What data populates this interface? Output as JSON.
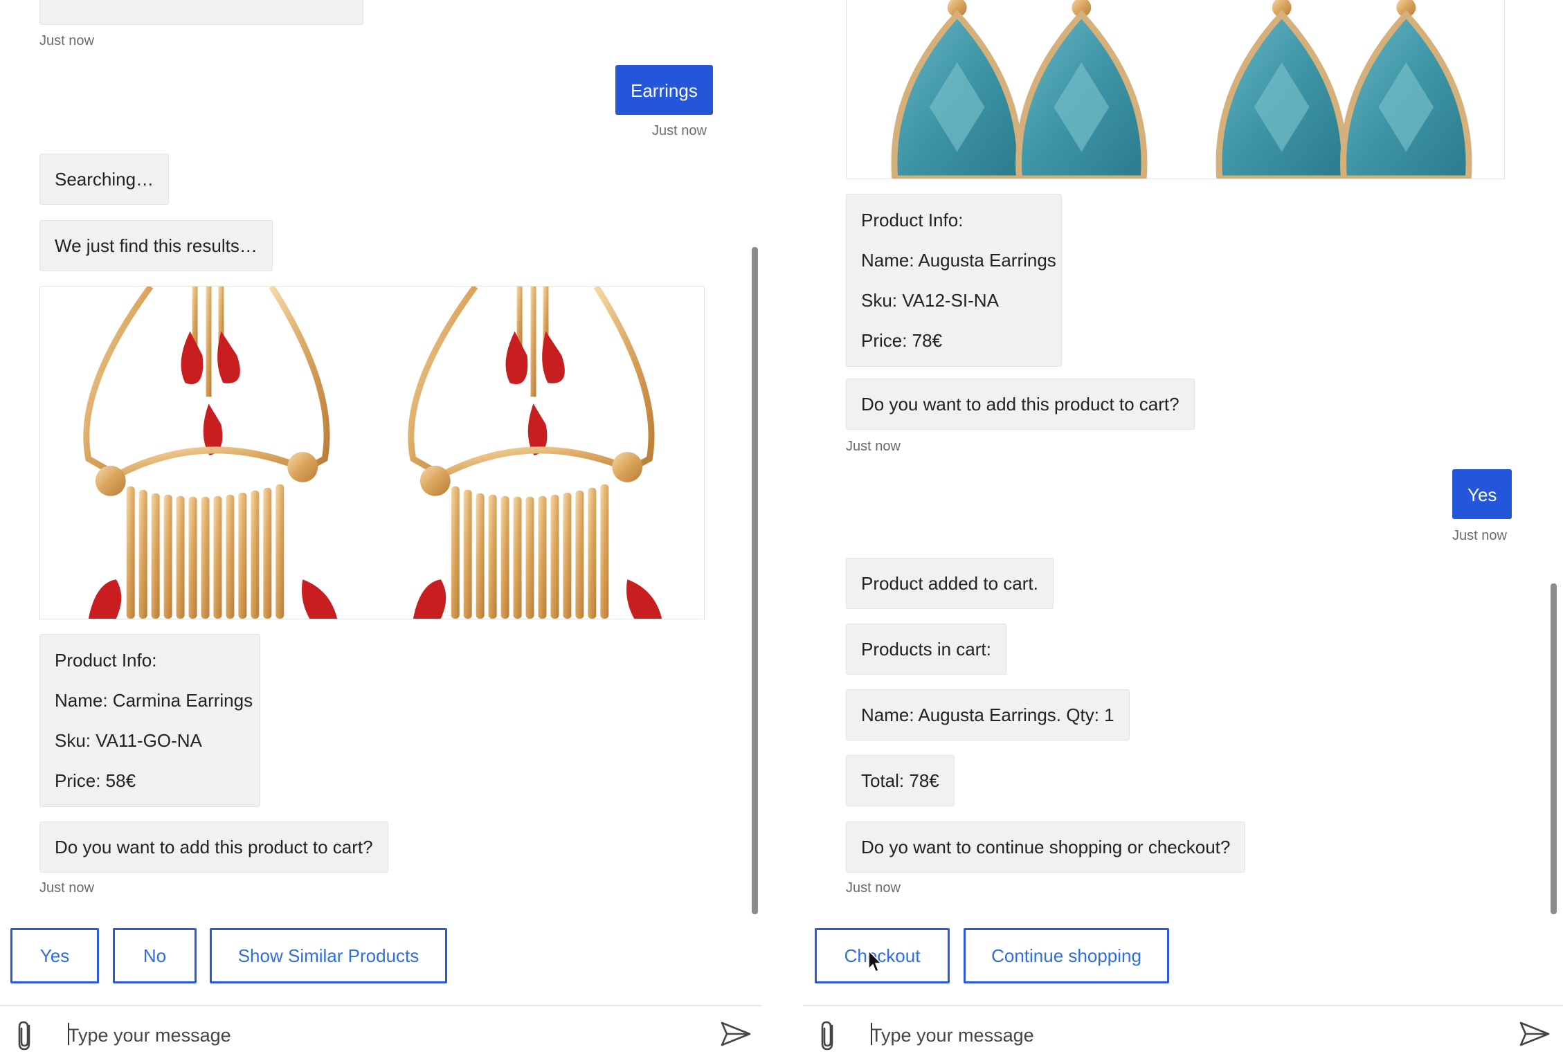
{
  "left_pane": {
    "top_time": "Just now",
    "user_msg": "Earrings",
    "user_time": "Just now",
    "searching": "Searching…",
    "results_intro": "We just find this results…",
    "product_info": {
      "heading": "Product Info:",
      "name": "Name: Carmina Earrings",
      "sku": "Sku: VA11-GO-NA",
      "price": "Price: 58€"
    },
    "add_question": "Do you want to add this product to cart?",
    "bot_time": "Just now",
    "quick_replies": [
      "Yes",
      "No",
      "Show Similar Products"
    ],
    "composer_placeholder": "Type your message"
  },
  "right_pane": {
    "product_info": {
      "heading": "Product Info:",
      "name": "Name: Augusta Earrings",
      "sku": "Sku: VA12-SI-NA",
      "price": "Price: 78€"
    },
    "add_question": "Do you want to add this product to cart?",
    "bot_time_1": "Just now",
    "user_msg": "Yes",
    "user_time": "Just now",
    "added": "Product added to cart.",
    "cart_heading": "Products in cart:",
    "cart_item": "Name: Augusta Earrings. Qty: 1",
    "total": "Total: 78€",
    "continue_question": "Do yo want to continue shopping or checkout?",
    "bot_time_2": "Just now",
    "quick_replies": [
      "Checkout",
      "Continue shopping"
    ],
    "composer_placeholder": "Type your message"
  },
  "colors": {
    "user_bubble": "#2356d8",
    "bot_bubble": "#f0f1f3",
    "quick_reply_border": "#2a5ad9",
    "quick_reply_text": "#2f6ee0"
  },
  "icons": {
    "attach": "paperclip-icon",
    "send": "send-icon",
    "cursor": "mouse-pointer-icon"
  }
}
